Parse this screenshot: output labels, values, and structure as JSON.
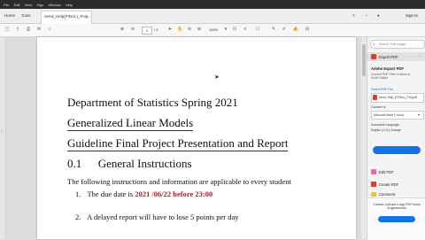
{
  "menu": [
    "File",
    "Edit",
    "View",
    "Sign",
    "Window",
    "Help"
  ],
  "tabs": {
    "home": "Home",
    "tools": "Tools",
    "document": "Send_Help(FINAL)_Proj..."
  },
  "header": {
    "sign_in": "Sign In"
  },
  "toolbar": {
    "page_current": "2",
    "page_total": "/ 3",
    "zoom": "100%"
  },
  "document": {
    "title": "Department of Statistics Spring 2021",
    "subtitle": "Generalized Linear Models",
    "heading": "Guideline Final Project Presentation and Report",
    "section_number": "0.1",
    "section_title": "General Instructions",
    "intro": "The following instructions and information are applicable to every student",
    "item1_num": "1.",
    "item1_text": "The due date is",
    "item1_date": "2021 /06/22 before 23:00",
    "item2_num": "2.",
    "item2_text": "A delayed report will have to lose 5 points per day"
  },
  "panel": {
    "search_placeholder": "Search 'Edit image'",
    "export_pdf": "Export PDF",
    "adobe_title": "Adobe Export PDF",
    "adobe_desc": "Convert PDF Files to Word or Excel Online",
    "select_label": "Select PDF File",
    "file_name": "Send_Help_(FINAL)_Proj.pdf",
    "convert_to_label": "Convert to",
    "convert_to_value": "Microsoft Word (*.docx)",
    "doc_lang_label": "Document Language:",
    "doc_lang_value": "English (U.S.) Change",
    "convert_button": "Convert",
    "edit_pdf": "Edit PDF",
    "create_pdf": "Create PDF",
    "comment": "Comment",
    "promo": "Convert, edit and e-sign PDF forms & agreements",
    "trial_button": "Free 7-Day Trial"
  },
  "colors": {
    "accent": "#1473e6",
    "red_text": "#c0121b",
    "export_red": "#e0392f"
  }
}
